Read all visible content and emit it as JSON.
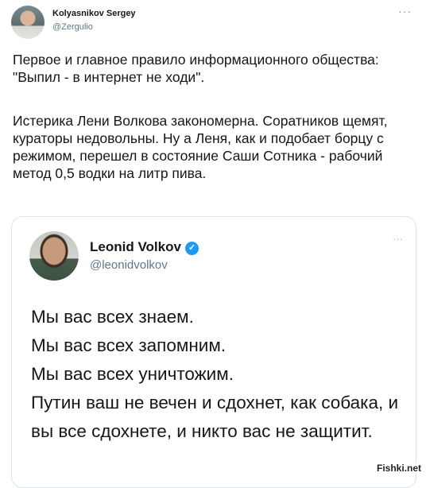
{
  "tweet": {
    "author": {
      "name": "Kolyasnikov Sergey",
      "handle": "@Zergulio"
    },
    "more_glyph": "···",
    "paragraph1": "Первое и главное правило информационного общества: \"Выпил - в интернет не ходи\".",
    "paragraph2": "Истерика Лени Волкова закономерна. Соратников щемят, кураторы недовольны. Ну а Леня, как и подобает борцу с режимом, перешел в состояние Саши Сотника - рабочий метод 0,5 водки на литр пива."
  },
  "quoted": {
    "author": {
      "name": "Leonid Volkov",
      "handle": "@leonidvolkov",
      "verified_glyph": "✓"
    },
    "more_glyph": "···",
    "text": "Мы вас всех знаем.\nМы вас всех запомним.\nМы вас всех уничтожим.\nПутин ваш не вечен и сдохнет, как собака, и вы все сдохнете, и никто вас не защитит."
  },
  "watermark": "Fishki.net"
}
